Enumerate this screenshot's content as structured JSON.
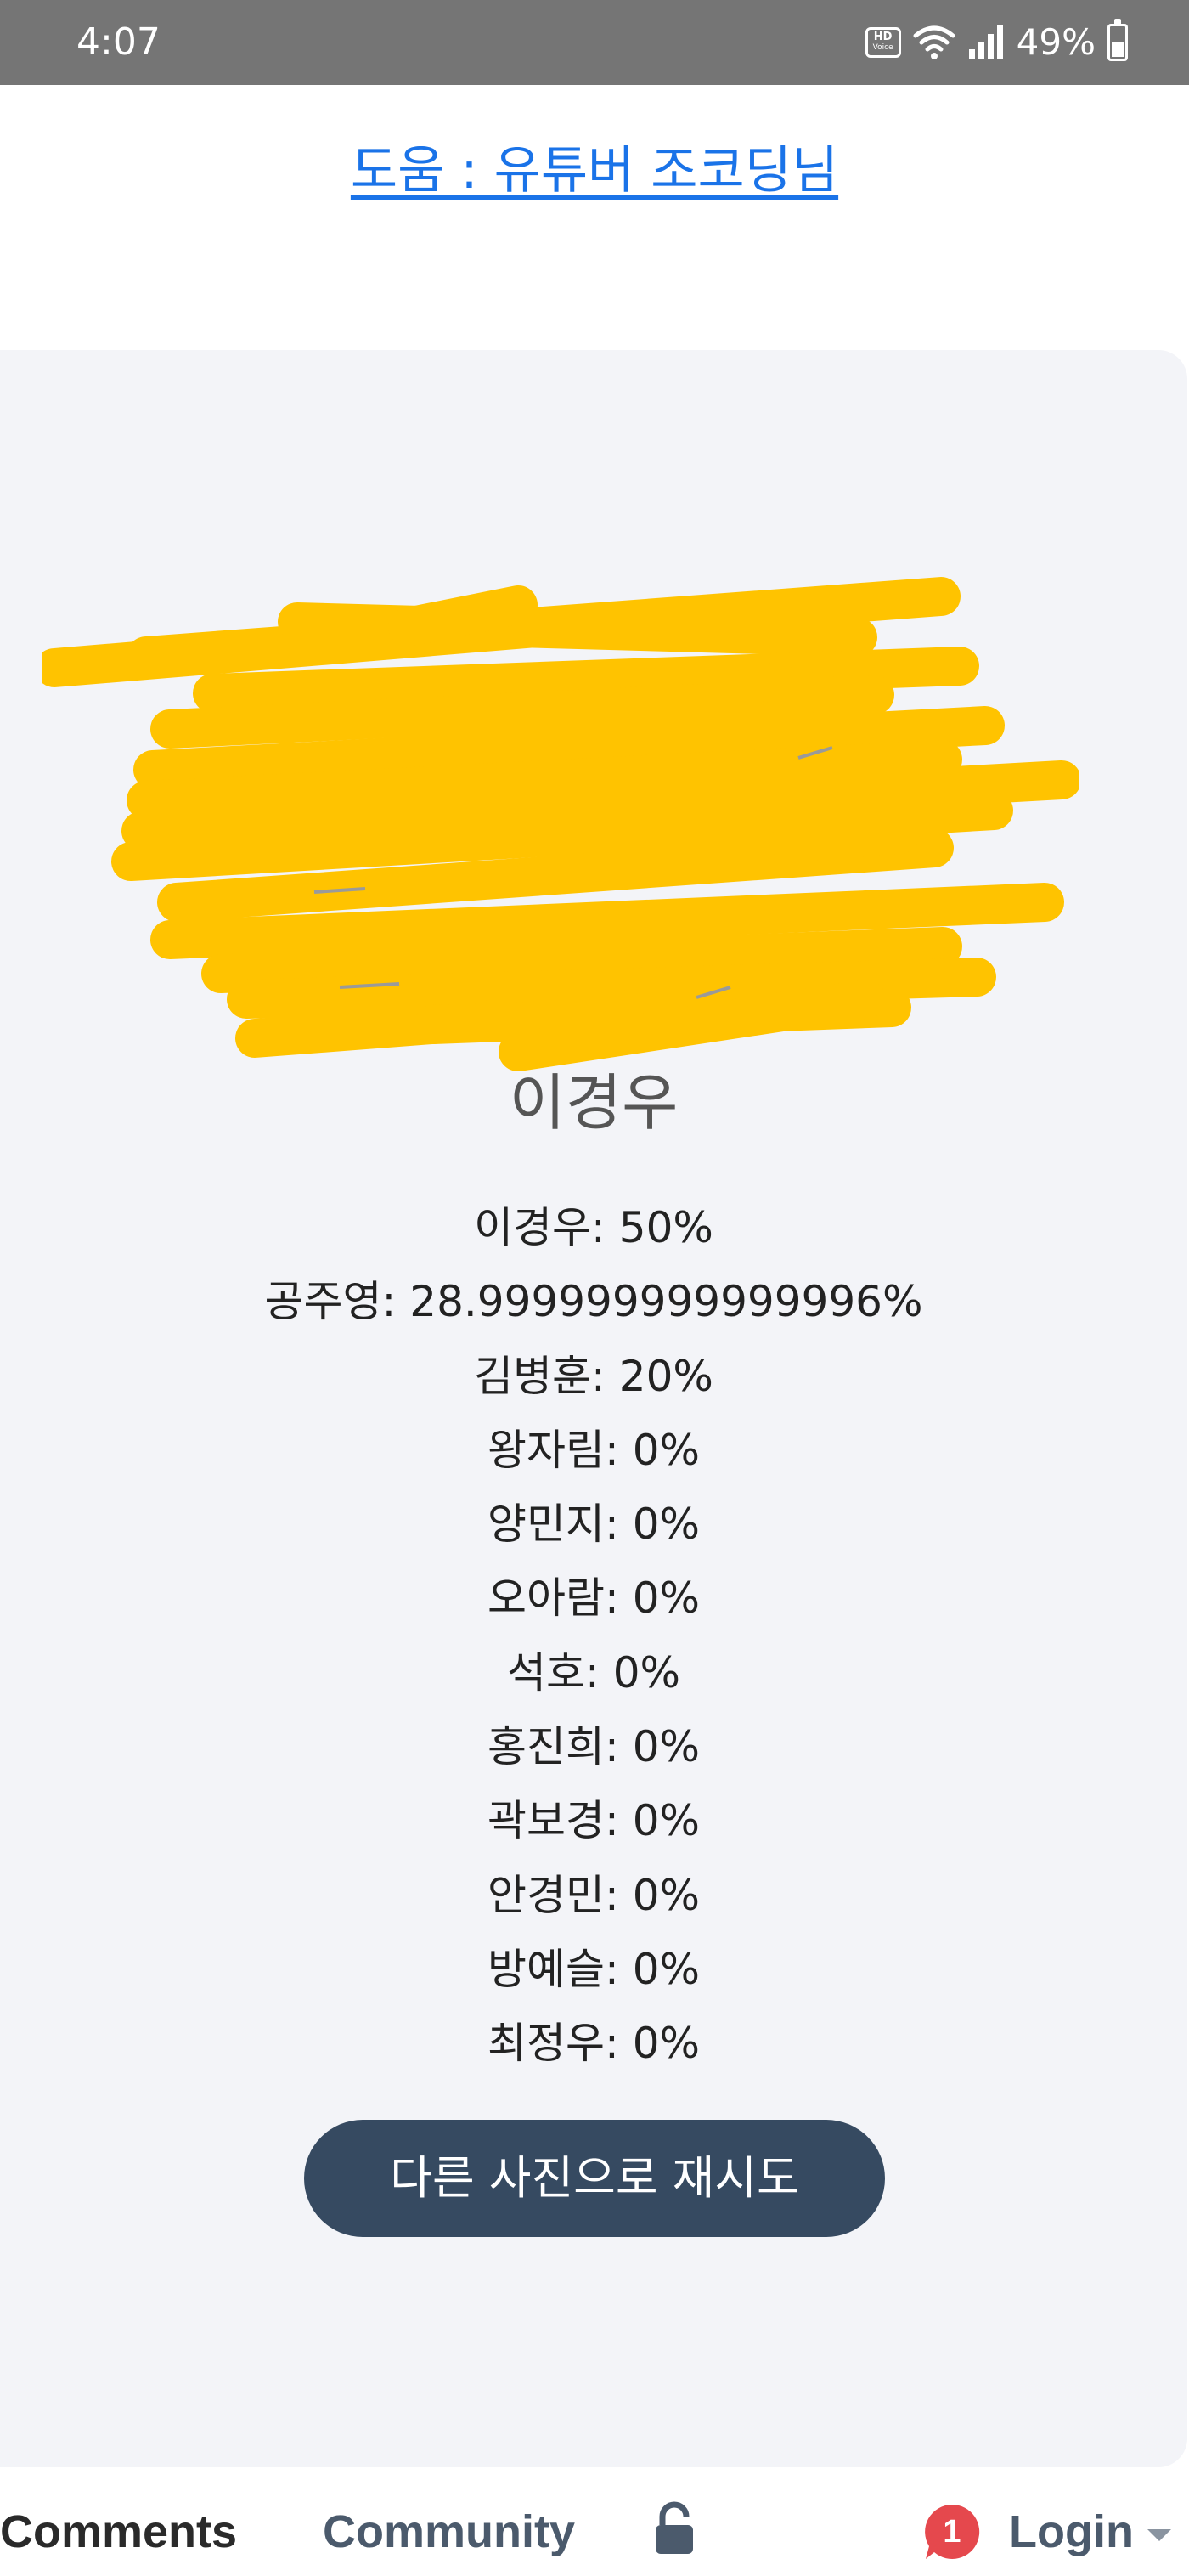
{
  "status_bar": {
    "time": "4:07",
    "hd_label": "HD",
    "hd_sub": "Voice",
    "battery": "49%",
    "icons": [
      "hd-voice-icon",
      "wifi-icon",
      "signal-icon",
      "battery-icon"
    ]
  },
  "links": {
    "help": "도움 : 유튜버 조코딩님"
  },
  "result": {
    "top_name": "이경우",
    "items": [
      "이경우: 50%",
      "공주영: 28.999999999999996%",
      "김병훈: 20%",
      "왕자림: 0%",
      "양민지: 0%",
      "오아람: 0%",
      "석호: 0%",
      "홍진희: 0%",
      "곽보경: 0%",
      "안경민: 0%",
      "방예슬: 0%",
      "최정우: 0%"
    ],
    "retry_label": "다른 사진으로 재시도"
  },
  "bottom_bar": {
    "comments_tab": "Comments",
    "community_tab": "Community",
    "notification_count": "1",
    "login_label": "Login"
  },
  "colors": {
    "link": "#1a73e8",
    "card_background": "#f3f4f8",
    "button": "#364a61",
    "scribble": "#ffc300",
    "badge": "#e5484d"
  }
}
